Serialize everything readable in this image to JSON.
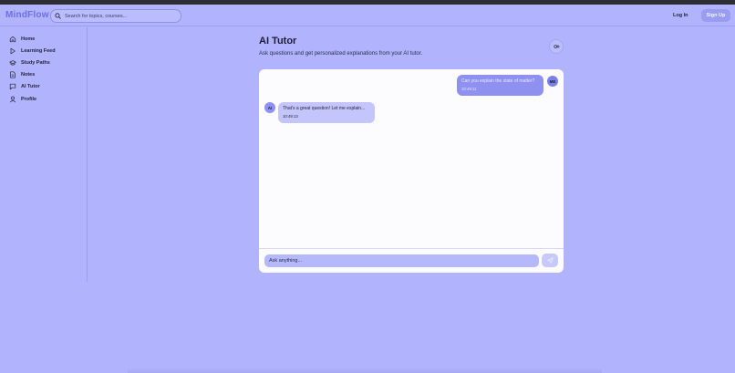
{
  "header": {
    "logo": "MindFlow",
    "search_placeholder": "Search for topics, courses...",
    "login_label": "Log In",
    "signup_label": "Sign Up"
  },
  "sidebar": {
    "items": [
      {
        "label": "Home",
        "icon": "home-icon"
      },
      {
        "label": "Learning Feed",
        "icon": "play-icon"
      },
      {
        "label": "Study Paths",
        "icon": "graduation-cap-icon"
      },
      {
        "label": "Notes",
        "icon": "document-icon"
      },
      {
        "label": "AI Tutor",
        "icon": "chat-icon"
      },
      {
        "label": "Profile",
        "icon": "user-icon"
      }
    ]
  },
  "main": {
    "title": "AI Tutor",
    "subtitle": "Ask questions and get personalized explanations from your AI tutor.",
    "settings_icon": "settings-sparkle-icon"
  },
  "chat": {
    "messages": [
      {
        "sender": "ME",
        "text": "Can you explain the state of matter?",
        "time": "10:49:11"
      },
      {
        "sender": "AI",
        "text": "That's a great question! Let me explain...",
        "time": "10:49:13"
      }
    ],
    "input_placeholder": "Ask anything...",
    "send_icon": "send-icon"
  },
  "colors": {
    "background": "#b1b3fc",
    "accent": "#6c6fe6",
    "user_bubble": "#8e91ef",
    "ai_bubble": "#c3c5fb",
    "card": "#fcfcff"
  }
}
